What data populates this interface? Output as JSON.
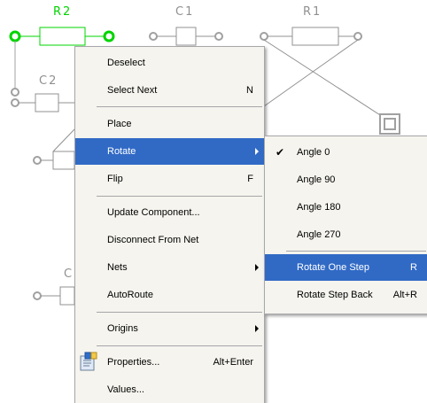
{
  "schematic": {
    "labels": {
      "r2": "R2",
      "c1": "C1",
      "r1": "R1",
      "c2": "C2",
      "c_partial": "C"
    },
    "colors": {
      "selected": "#00d400",
      "wire": "#909090",
      "pin": "#a0a0a0",
      "text": "#909090"
    }
  },
  "context_menu": {
    "items": [
      {
        "label": "Deselect",
        "shortcut": ""
      },
      {
        "label": "Select Next",
        "shortcut": "N"
      },
      {
        "label": "Place",
        "shortcut": ""
      },
      {
        "label": "Rotate",
        "shortcut": "",
        "submenu": true,
        "highlighted": true
      },
      {
        "label": "Flip",
        "shortcut": "F"
      },
      {
        "label": "Update Component...",
        "shortcut": ""
      },
      {
        "label": "Disconnect From Net",
        "shortcut": ""
      },
      {
        "label": "Nets",
        "shortcut": "",
        "submenu": true
      },
      {
        "label": "AutoRoute",
        "shortcut": ""
      },
      {
        "label": "Origins",
        "shortcut": "",
        "submenu": true
      },
      {
        "label": "Properties...",
        "shortcut": "Alt+Enter",
        "icon": "properties-icon"
      },
      {
        "label": "Values...",
        "shortcut": ""
      }
    ]
  },
  "rotate_submenu": {
    "items": [
      {
        "label": "Angle 0",
        "shortcut": "",
        "checked": true
      },
      {
        "label": "Angle 90",
        "shortcut": ""
      },
      {
        "label": "Angle 180",
        "shortcut": ""
      },
      {
        "label": "Angle 270",
        "shortcut": ""
      },
      {
        "label": "Rotate One Step",
        "shortcut": "R",
        "highlighted": true
      },
      {
        "label": "Rotate Step Back",
        "shortcut": "Alt+R"
      }
    ],
    "check_mark": "✔"
  },
  "accent_color": "#316ac5"
}
